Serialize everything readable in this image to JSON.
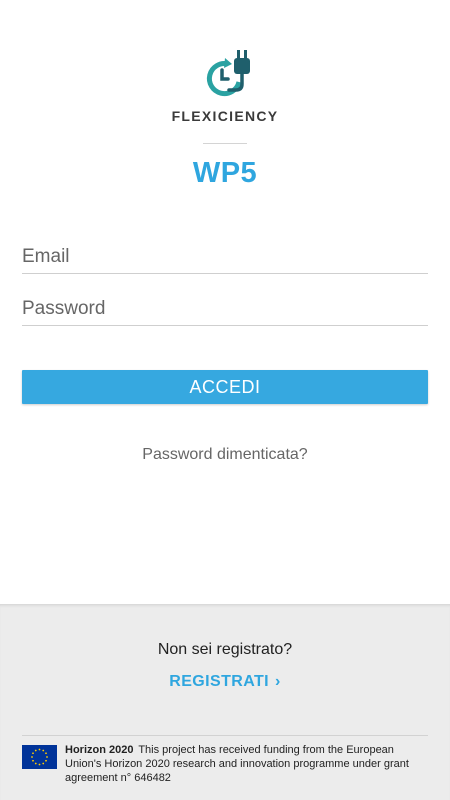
{
  "brand": {
    "name": "FLEXICIENCY",
    "logo_icon": "clock-plug-icon",
    "subtitle": "WP5"
  },
  "login": {
    "email_placeholder": "Email",
    "email_value": "",
    "password_placeholder": "Password",
    "password_value": "",
    "submit_label": "ACCEDI",
    "forgot_label": "Password dimenticata?"
  },
  "register": {
    "prompt": "Non sei registrato?",
    "link_label": "REGISTRATI",
    "chevron": "›"
  },
  "footer": {
    "program": "Horizon 2020",
    "funding_text": "This project has received funding from the European Union's Horizon 2020 research and innovation programme under grant agreement n° 646482",
    "flag_icon": "eu-flag-icon"
  },
  "colors": {
    "accent": "#2fa6df",
    "button": "#36a8e0",
    "logo_dark": "#1f5f6c",
    "logo_teal": "#2aa2a2",
    "footer_bg": "#ececec",
    "eu_blue": "#003399",
    "eu_yellow": "#ffcc00"
  }
}
